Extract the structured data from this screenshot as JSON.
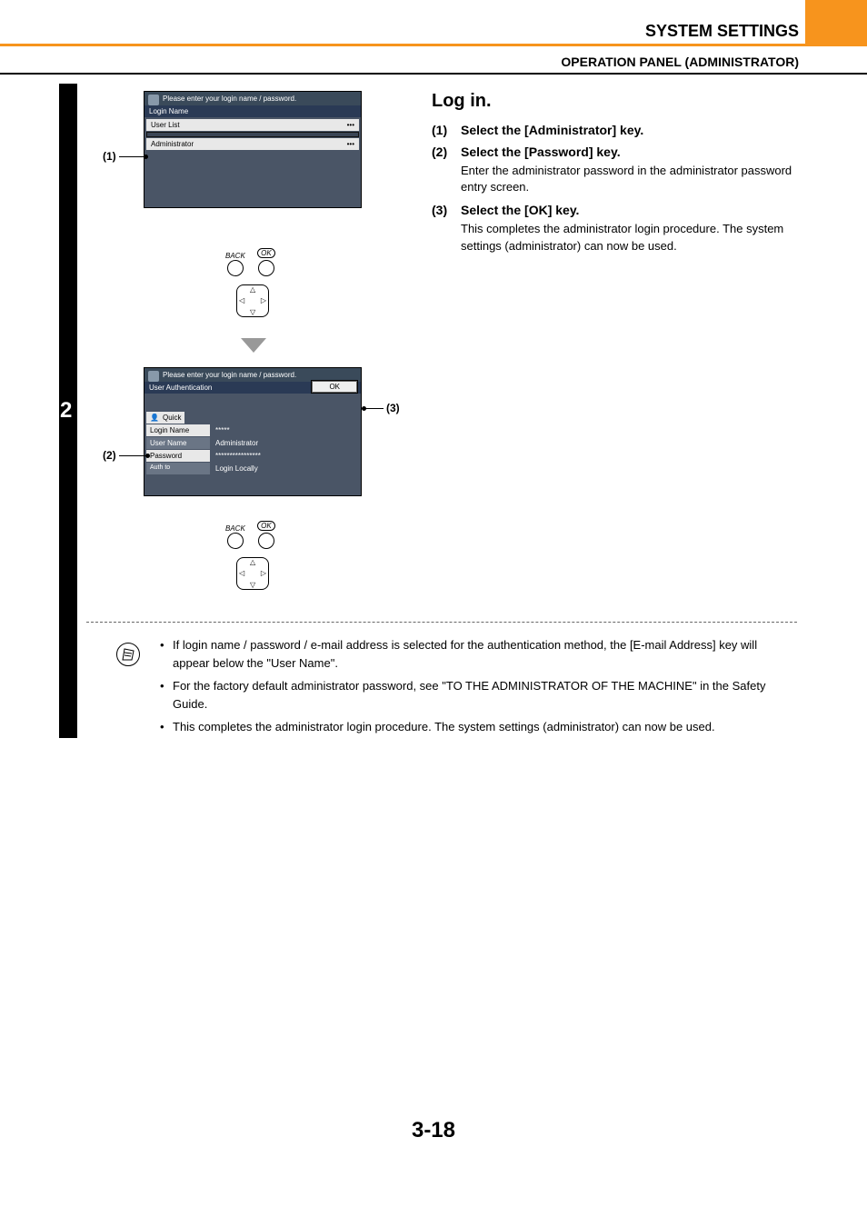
{
  "header": {
    "title": "SYSTEM SETTINGS",
    "subtitle": "OPERATION PANEL (ADMINISTRATOR)"
  },
  "step_number": "2",
  "panel1": {
    "prompt": "Please enter your login name / password.",
    "section": "Login Name",
    "row1": "User List",
    "row2": "Administrator"
  },
  "controls": {
    "back": "BACK",
    "ok": "OK"
  },
  "panel2": {
    "prompt": "Please enter your login name / password.",
    "section": "User Authentication",
    "quick": "Quick",
    "login_name_k": "Login Name",
    "login_name_v": "*****",
    "user_name_k": "User Name",
    "user_name_v": "Administrator",
    "password_k": "Password",
    "password_v": "****************",
    "auth_to_k": "Auth to",
    "auth_to_v": "Login Locally",
    "ok_btn": "OK"
  },
  "callouts": {
    "c1": "(1)",
    "c2": "(2)",
    "c3": "(3)"
  },
  "instructions": {
    "heading": "Log in.",
    "s1_num": "(1)",
    "s1_title": "Select the [Administrator] key.",
    "s2_num": "(2)",
    "s2_title": "Select the [Password] key.",
    "s2_body": "Enter the administrator password in the administrator password entry screen.",
    "s3_num": "(3)",
    "s3_title": "Select the [OK] key.",
    "s3_body": "This completes the administrator login procedure. The system settings (administrator) can now be used."
  },
  "notes": {
    "n1": "If login name / password / e-mail address is selected for the authentication method, the [E-mail Address] key will appear below the \"User Name\".",
    "n2": "For the factory default administrator password, see \"TO THE ADMINISTRATOR OF THE MACHINE\" in the  Safety Guide.",
    "n3": "This completes the administrator login procedure. The system settings (administrator) can now be used."
  },
  "page_number": "3-18"
}
